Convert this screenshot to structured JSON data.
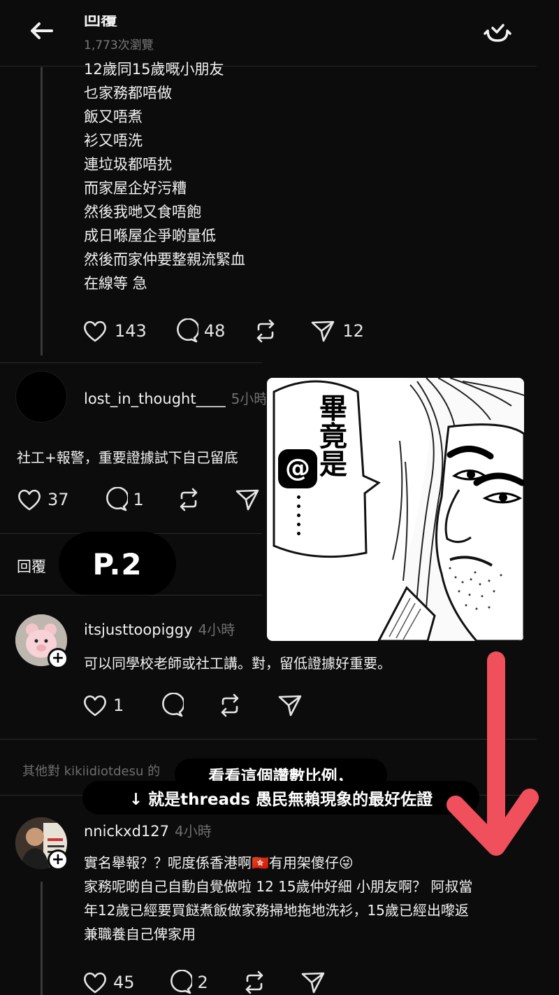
{
  "header": {
    "title": "回覆",
    "views": "1,773次瀏覽"
  },
  "post1": {
    "lines": "12歲同15歲嘅小朋友\n乜家務都唔做\n飯又唔煮\n衫又唔洗\n￼連垃圾都唔抌\n而家屋企好污糟\n然後我哋又食唔飽\n成日喺屋企爭啲量低\n然後而家仲要整親流緊血\n在線等 急",
    "likes": "143",
    "comments": "48",
    "shares": "12"
  },
  "reply1": {
    "username": "lost_in_thought____",
    "time": "5小時",
    "text": "社工+報警，重要證據試下自己留底",
    "likes": "37",
    "comments": "1"
  },
  "replies_label": "回覆",
  "page_badge": "P.2",
  "reply2": {
    "username": "itsjusttoopiggy",
    "time": "4小時",
    "text": "可以同學校老師或社工講。對，留低證據好重要。",
    "likes": "1"
  },
  "other_replies": "其他對 kikiidiotdesu 的",
  "reply3": {
    "username": "nnickxd127",
    "time": "4小時",
    "text": "實名舉報？？呢度係香港啊🇭🇰有用架傻仔😜\n家務呢啲自己自動自覺做啦 12 15歲仲好細 小朋友啊？ 阿叔當\n年12歲已經要買餸煮飯做家務掃地拖地洗衫，15歲已經出嚟返\n兼職養自己俾家用",
    "likes": "45",
    "comments": "2"
  },
  "manga": {
    "bubble_text": "畢竟是",
    "dots": "⋮"
  },
  "captions": {
    "line1": "看看這個讚數比例，",
    "line2": "↓ 就是threads 愚民無賴現象的最好佐證"
  },
  "colors": {
    "background": "#0c0c0c",
    "arrow": "#f0505c",
    "muted": "#6e6e6e"
  }
}
